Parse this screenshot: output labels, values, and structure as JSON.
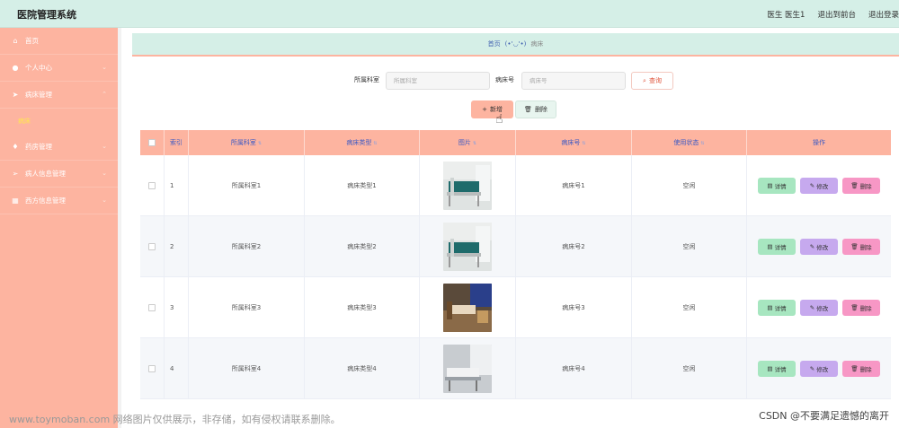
{
  "app": {
    "title": "医院管理系统"
  },
  "topbar": {
    "user": "医生 医生1",
    "to_front": "退出到前台",
    "logout": "退出登录"
  },
  "sidebar": {
    "items": [
      {
        "label": "首页",
        "icon": "home-icon"
      },
      {
        "label": "个人中心",
        "icon": "user-icon"
      },
      {
        "label": "病床管理",
        "icon": "send-icon"
      },
      {
        "label": "药房管理",
        "icon": "mic-icon"
      },
      {
        "label": "病人信息管理",
        "icon": "paper-plane-icon"
      },
      {
        "label": "西方信息管理",
        "icon": "grid-icon"
      }
    ],
    "sub_item": "病床"
  },
  "breadcrumb": {
    "home": "首页",
    "face": "(•'◡'•)",
    "current": "病床"
  },
  "search": {
    "dept_label": "所属科室",
    "dept_placeholder": "所属科室",
    "bed_label": "病床号",
    "bed_placeholder": "病床号",
    "query_label": "查询"
  },
  "actions": {
    "add_label": "新增",
    "delete_label": "删除"
  },
  "table": {
    "columns": [
      "索引",
      "所属科室",
      "病床类型",
      "图片",
      "病床号",
      "使用状态",
      "操作"
    ],
    "rows": [
      {
        "index": "1",
        "dept": "所属科室1",
        "type": "病床类型1",
        "bed": "病床号1",
        "status": "空闲"
      },
      {
        "index": "2",
        "dept": "所属科室2",
        "type": "病床类型2",
        "bed": "病床号2",
        "status": "空闲"
      },
      {
        "index": "3",
        "dept": "所属科室3",
        "type": "病床类型3",
        "bed": "病床号3",
        "status": "空闲"
      },
      {
        "index": "4",
        "dept": "所属科室4",
        "type": "病床类型4",
        "bed": "病床号4",
        "status": "空闲"
      }
    ],
    "op_detail": "详情",
    "op_edit": "修改",
    "op_delete": "删除"
  },
  "watermark": {
    "left": "www.toymoban.com 网络图片仅供展示，非存储，如有侵权请联系删除。",
    "right": "CSDN @不要满足遗憾的离开"
  },
  "colors": {
    "accent": "#fdb4a0",
    "header_bg": "#d5efe7",
    "link": "#3a59c4"
  }
}
